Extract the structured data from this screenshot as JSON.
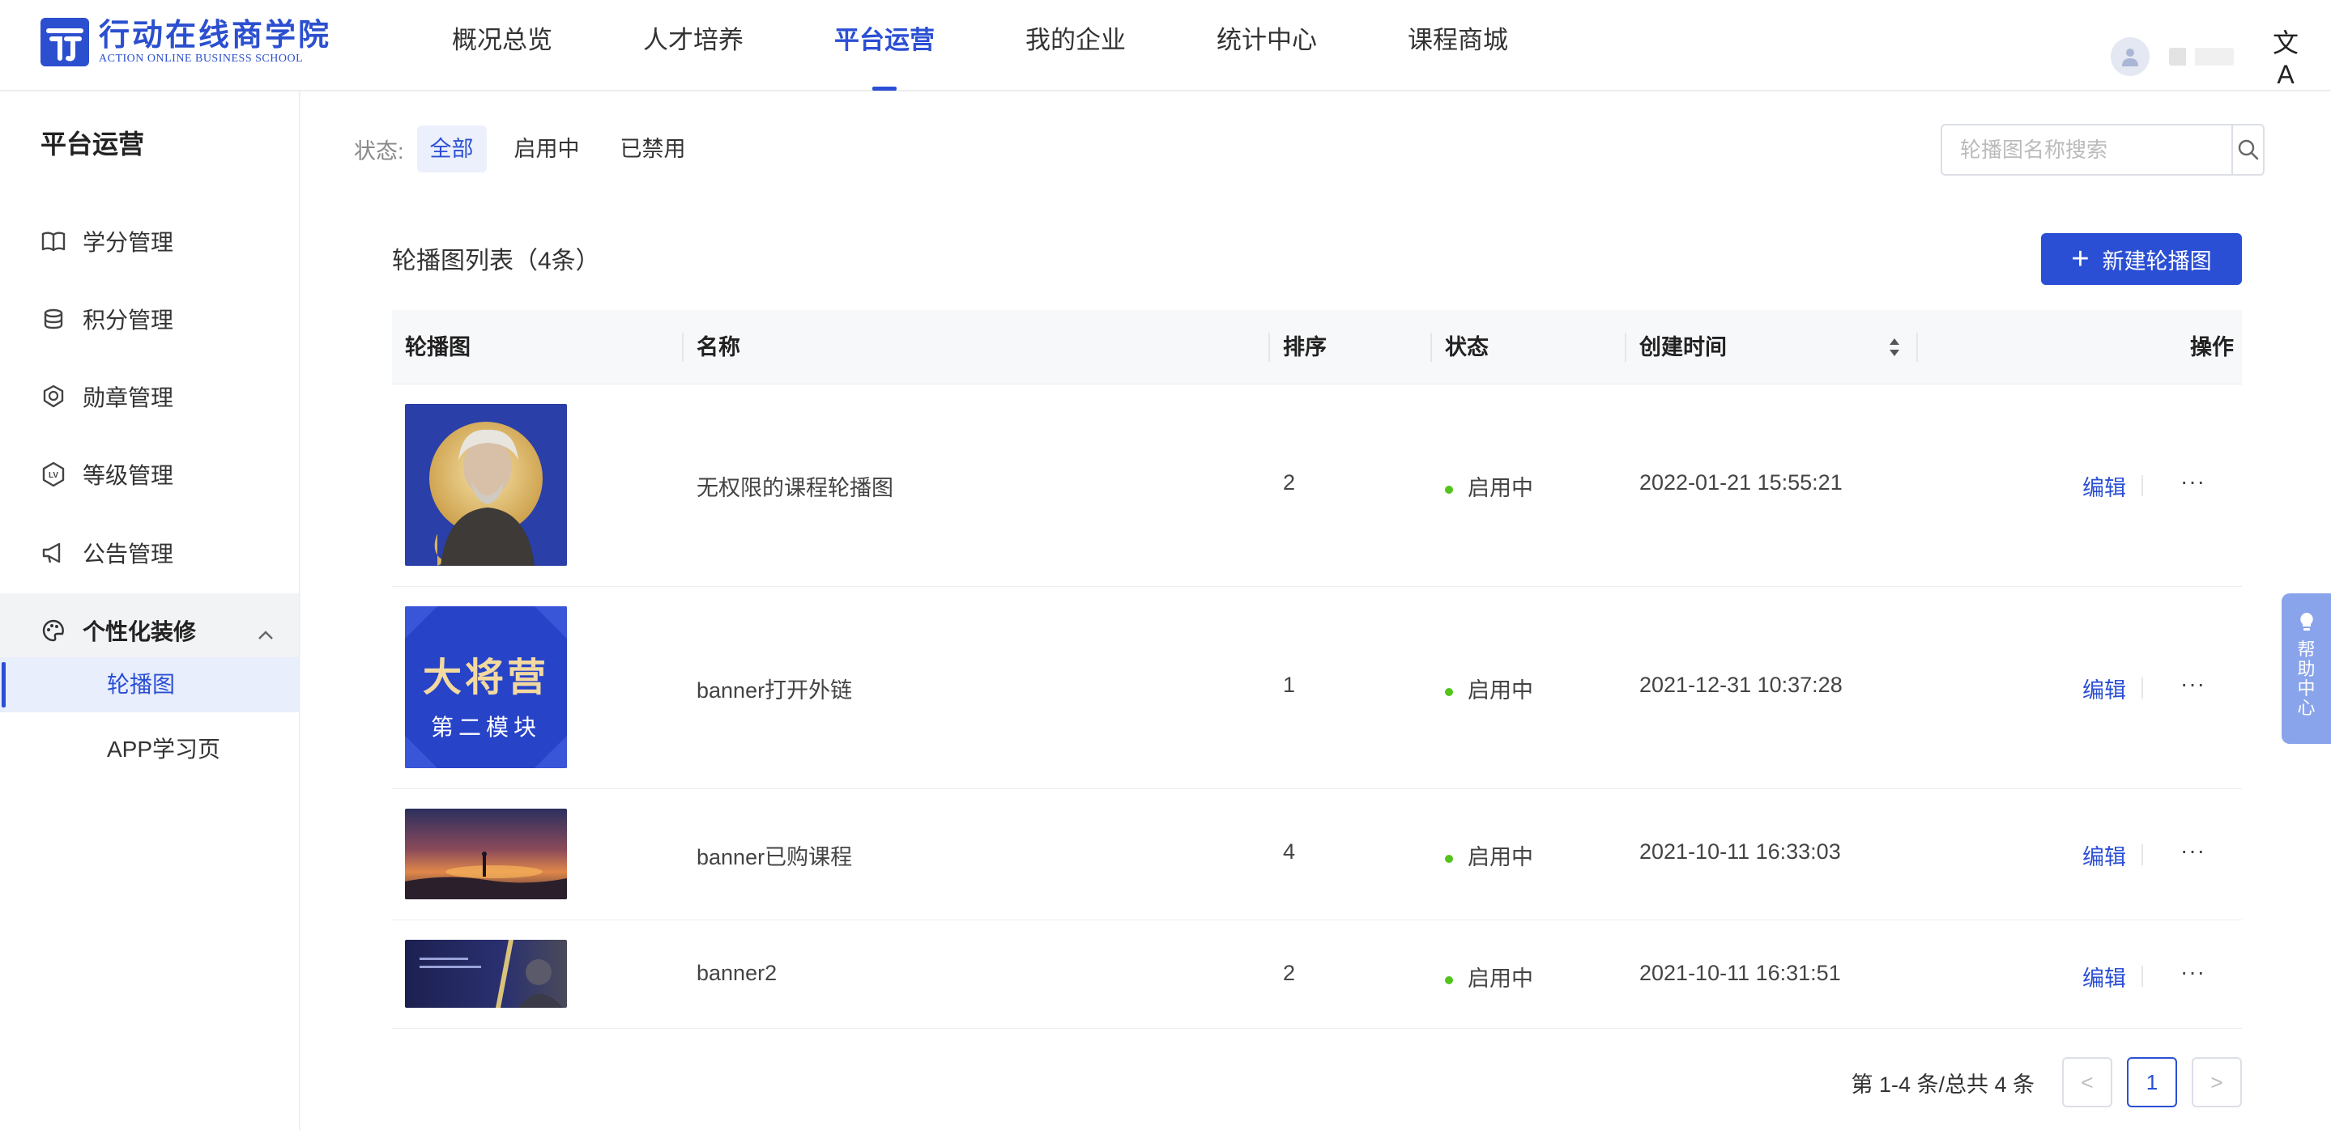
{
  "brand": {
    "name_cn": "行动在线商学院",
    "name_en": "ACTION ONLINE BUSINESS SCHOOL"
  },
  "nav": {
    "items": [
      {
        "label": "概况总览"
      },
      {
        "label": "人才培养"
      },
      {
        "label": "平台运营",
        "active": true
      },
      {
        "label": "我的企业"
      },
      {
        "label": "统计中心"
      },
      {
        "label": "课程商城"
      }
    ],
    "lang_icon": "文A"
  },
  "sidebar": {
    "title": "平台运营",
    "items": [
      {
        "label": "学分管理",
        "icon": "book-icon"
      },
      {
        "label": "积分管理",
        "icon": "coins-icon"
      },
      {
        "label": "勋章管理",
        "icon": "medal-icon"
      },
      {
        "label": "等级管理",
        "icon": "level-icon"
      },
      {
        "label": "公告管理",
        "icon": "megaphone-icon"
      },
      {
        "label": "个性化装修",
        "icon": "palette-icon",
        "expanded": true
      }
    ],
    "subitems": [
      {
        "label": "轮播图",
        "active": true
      },
      {
        "label": "APP学习页"
      }
    ]
  },
  "filter": {
    "label": "状态:",
    "options": [
      "全部",
      "启用中",
      "已禁用"
    ],
    "selected": "全部"
  },
  "search": {
    "placeholder": "轮播图名称搜索"
  },
  "list": {
    "title": "轮播图列表（4条）",
    "new_button": "新建轮播图"
  },
  "table": {
    "columns": [
      "轮播图",
      "名称",
      "排序",
      "状态",
      "创建时间",
      "操作"
    ],
    "rows": [
      {
        "name": "无权限的课程轮播图",
        "order": "2",
        "status": "启用中",
        "created": "2022-01-21 15:55:21",
        "edit": "编辑",
        "more": "···"
      },
      {
        "name": "banner打开外链",
        "order": "1",
        "status": "启用中",
        "created": "2021-12-31 10:37:28",
        "edit": "编辑",
        "more": "···"
      },
      {
        "name": "banner已购课程",
        "order": "4",
        "status": "启用中",
        "created": "2021-10-11 16:33:03",
        "edit": "编辑",
        "more": "···"
      },
      {
        "name": "banner2",
        "order": "2",
        "status": "启用中",
        "created": "2021-10-11 16:31:51",
        "edit": "编辑",
        "more": "···"
      }
    ],
    "thumb2": {
      "line1": "大将营",
      "line2": "第二模块"
    }
  },
  "pagination": {
    "summary": "第 1-4 条/总共 4 条",
    "current": "1",
    "prev": "<",
    "next": ">"
  },
  "help": {
    "label": "帮助中心"
  },
  "colors": {
    "primary": "#2b4fd4",
    "status_enabled": "#52c41a",
    "help_tab": "#8aa4ec"
  }
}
